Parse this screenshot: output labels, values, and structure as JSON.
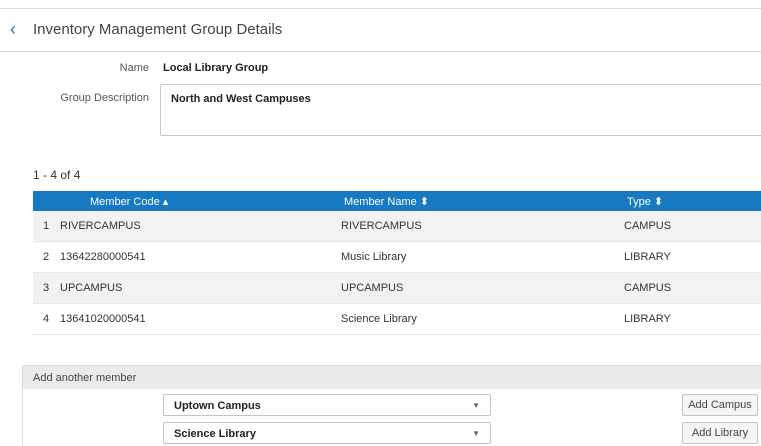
{
  "header": {
    "title": "Inventory Management Group Details",
    "back_icon": "chevron-left-icon"
  },
  "form": {
    "name_label": "Name",
    "name_value": "Local Library Group",
    "description_label": "Group Description",
    "description_value": "North and West Campuses"
  },
  "pager": {
    "text": "1 - 4 of 4"
  },
  "table": {
    "columns": [
      "Member Code ▴",
      "Member Name ⬍",
      "Type ⬍"
    ],
    "rows": [
      {
        "index": "1",
        "code": "RIVERCAMPUS",
        "name": "RIVERCAMPUS",
        "type": "CAMPUS"
      },
      {
        "index": "2",
        "code": "13642280000541",
        "name": "Music Library",
        "type": "LIBRARY"
      },
      {
        "index": "3",
        "code": "UPCAMPUS",
        "name": "UPCAMPUS",
        "type": "CAMPUS"
      },
      {
        "index": "4",
        "code": "13641020000541",
        "name": "Science Library",
        "type": "LIBRARY"
      }
    ]
  },
  "add_member": {
    "title": "Add another member",
    "campus_select": "Uptown Campus",
    "library_select": "Science Library",
    "add_campus_label": "Add Campus",
    "add_library_label": "Add Library"
  },
  "colors": {
    "accent": "#1679c2",
    "link": "#2a6ebb"
  }
}
